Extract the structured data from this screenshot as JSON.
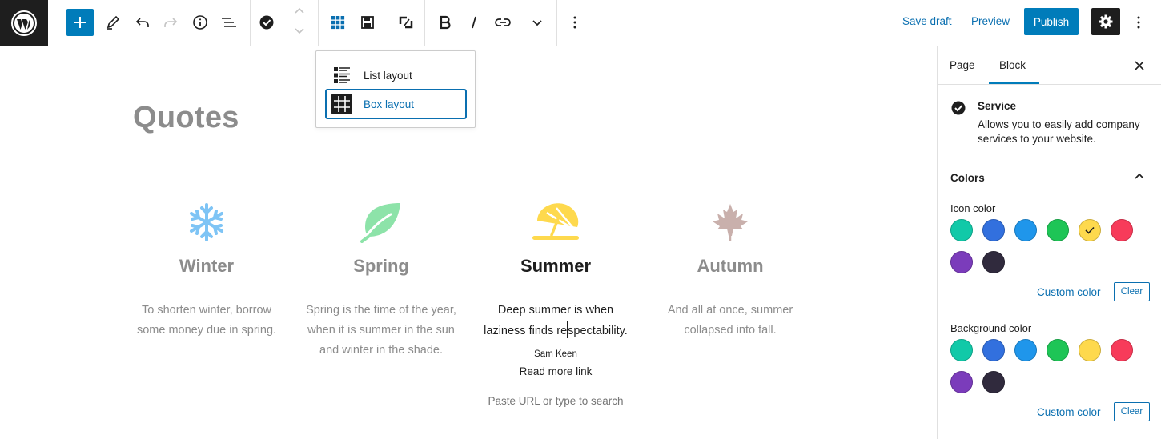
{
  "topbar": {
    "save_draft": "Save draft",
    "preview": "Preview",
    "publish": "Publish",
    "icons": [
      "wordpress-logo",
      "plus",
      "pencil",
      "undo",
      "redo",
      "info",
      "list-view",
      "check-circle",
      "chevron-up",
      "chevron-down",
      "grid",
      "save",
      "transform",
      "bold",
      "italic",
      "link",
      "chevron-down",
      "more-vertical",
      "gear",
      "more-vertical"
    ]
  },
  "popover": {
    "list_layout": "List layout",
    "box_layout": "Box layout"
  },
  "editor": {
    "title": "Quotes",
    "columns": [
      {
        "heading": "Winter",
        "text": "To shorten winter, borrow some money due in spring.",
        "icon": "snowflake",
        "color": "#7ec4f5"
      },
      {
        "heading": "Spring",
        "text": "Spring is the time of the year, when it is summer in the sun and winter in the shade.",
        "icon": "leaf",
        "color": "#8de3a9"
      },
      {
        "heading": "Summer",
        "text_line1": "Deep summer is when",
        "text_line2a": "laziness finds re",
        "text_line2b": "spectability.",
        "author": "Sam Keen",
        "read_more": "Read more link",
        "url_placeholder": "Paste URL or type to search",
        "icon": "beach-umbrella",
        "color": "#fed94d"
      },
      {
        "heading": "Autumn",
        "text": "And all at once, summer collapsed into fall.",
        "icon": "maple-leaf",
        "color": "#c9b0ac"
      }
    ]
  },
  "sidebar": {
    "tabs": {
      "page": "Page",
      "block": "Block"
    },
    "block": {
      "title": "Service",
      "description": "Allows you to easily add company services to your website."
    },
    "colors_panel": {
      "title": "Colors",
      "icon_color_label": "Icon color",
      "background_color_label": "Background color",
      "custom_color": "Custom color",
      "clear": "Clear",
      "palette": [
        "#11c9a8",
        "#3270de",
        "#1f96eb",
        "#1ec556",
        "#fed94d",
        "#f73b5a",
        "#7b3cbb",
        "#302a3d"
      ],
      "icon_selected": "#fed94d"
    }
  }
}
